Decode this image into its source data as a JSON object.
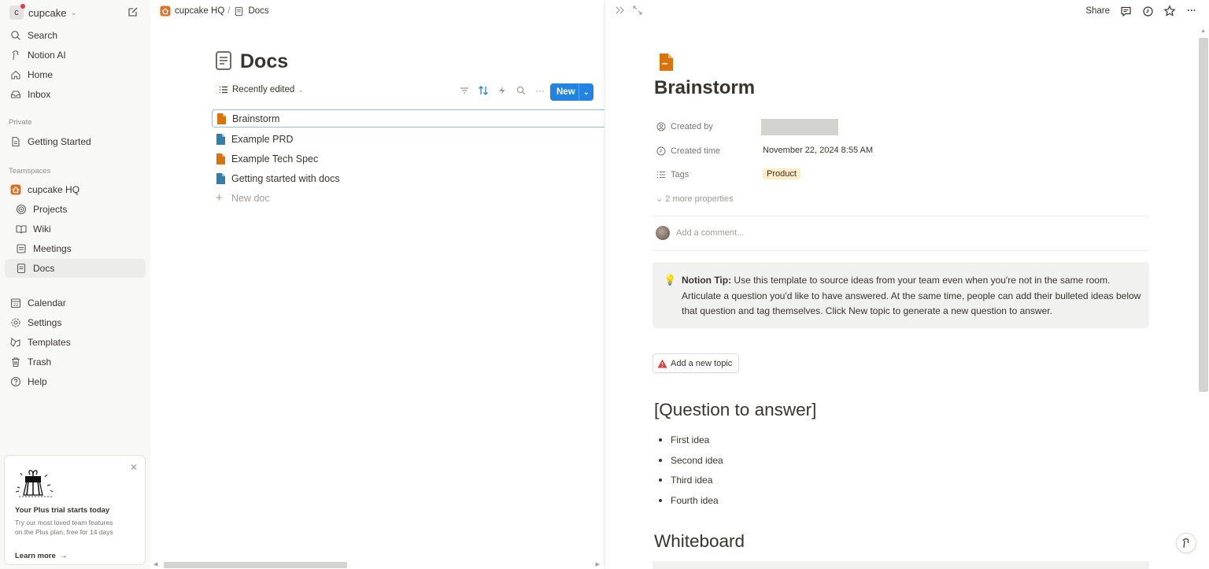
{
  "workspace": {
    "initial": "c",
    "name": "cupcake"
  },
  "sidebar": {
    "top_items": [
      {
        "label": "Search",
        "icon": "search-icon"
      },
      {
        "label": "Notion AI",
        "icon": "notion-ai-icon"
      },
      {
        "label": "Home",
        "icon": "home-icon"
      },
      {
        "label": "Inbox",
        "icon": "inbox-icon"
      }
    ],
    "private_label": "Private",
    "private_items": [
      {
        "label": "Getting Started",
        "icon": "page-icon"
      }
    ],
    "teamspaces_label": "Teamspaces",
    "teamspace": {
      "label": "cupcake HQ",
      "icon": "house-icon"
    },
    "team_items": [
      {
        "label": "Projects",
        "icon": "target-icon"
      },
      {
        "label": "Wiki",
        "icon": "book-icon"
      },
      {
        "label": "Meetings",
        "icon": "calendar-page-icon"
      },
      {
        "label": "Docs",
        "icon": "doc-icon"
      }
    ],
    "bottom_items": [
      {
        "label": "Calendar",
        "icon": "calendar-icon"
      },
      {
        "label": "Settings",
        "icon": "gear-icon"
      },
      {
        "label": "Templates",
        "icon": "templates-icon"
      },
      {
        "label": "Trash",
        "icon": "trash-icon"
      },
      {
        "label": "Help",
        "icon": "help-icon"
      }
    ],
    "trial": {
      "title": "Your Plus trial starts today",
      "description": "Try our most loved team features on the Plus plan, free for 14 days",
      "learn_more": "Learn more"
    }
  },
  "breadcrumb": {
    "teamspace": "cupcake HQ",
    "separator": "/",
    "page": "Docs"
  },
  "page": {
    "title": "Docs",
    "view_label": "Recently edited",
    "new_button": "New",
    "docs": [
      {
        "title": "Brainstorm",
        "color": "#d9730d"
      },
      {
        "title": "Example PRD",
        "color": "#337ea9"
      },
      {
        "title": "Example Tech Spec",
        "color": "#d9730d"
      },
      {
        "title": "Getting started with docs",
        "color": "#337ea9"
      }
    ],
    "new_doc_label": "New doc"
  },
  "peek": {
    "share_label": "Share",
    "doc_title": "Brainstorm",
    "properties": {
      "created_by_label": "Created by",
      "created_time_label": "Created time",
      "created_time_value": "November 22, 2024 8:55 AM",
      "tags_label": "Tags",
      "tag_value": "Product",
      "more_label": "2 more properties"
    },
    "comment_placeholder": "Add a comment...",
    "callout": {
      "bold": "Notion Tip:",
      "text": " Use this template to source ideas from your team even when you're not in the same room. Articulate a question you'd like to have answered. At the same time, people can add their bulleted ideas below that question and tag themselves. Click New topic to generate a new question to answer."
    },
    "add_topic_label": "Add a new topic",
    "question_heading": "[Question to answer]",
    "ideas": [
      "First idea",
      "Second idea",
      "Third idea",
      "Fourth idea"
    ],
    "whiteboard_heading": "Whiteboard"
  },
  "colors": {
    "accent": "#2383e2",
    "orange": "#d9730d",
    "blue": "#337ea9",
    "tag_bg": "#fdecc8",
    "warning": "#e03e3e"
  }
}
